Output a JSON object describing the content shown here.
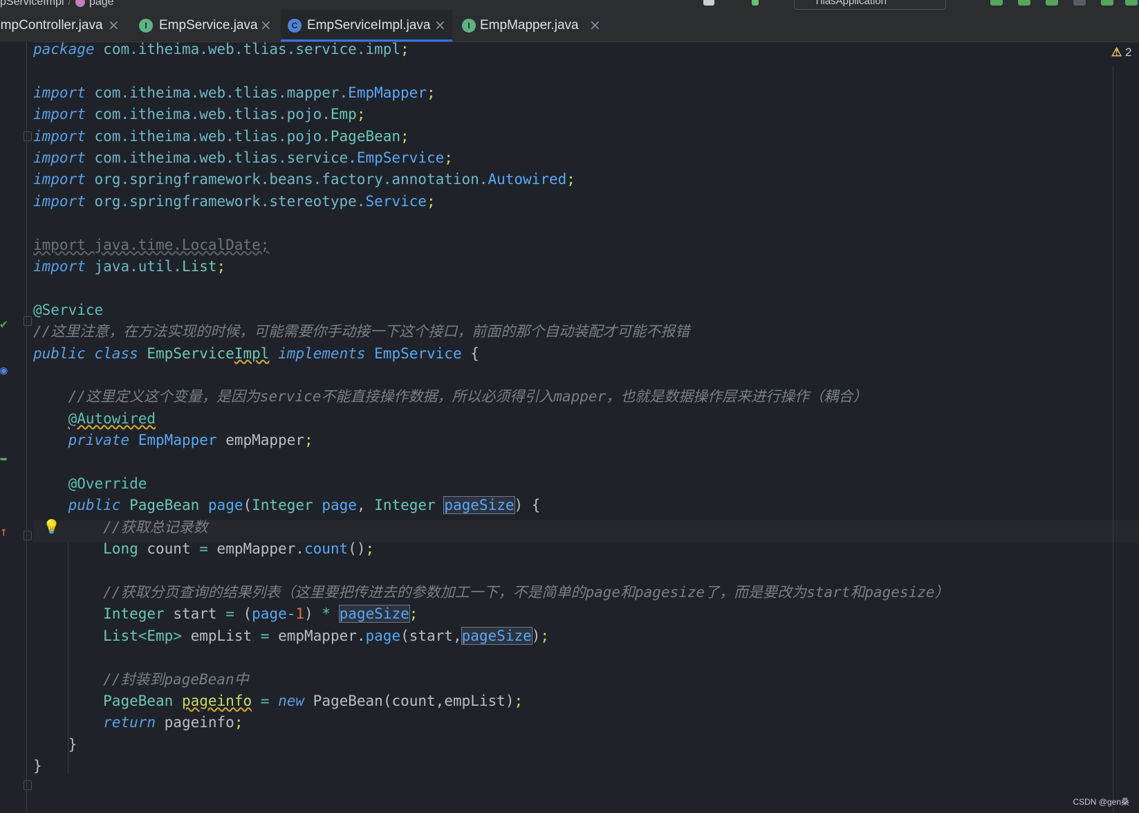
{
  "breadcrumb": {
    "class_part": "pServiceImpl",
    "separator": "/",
    "method": "page"
  },
  "run_config": {
    "label": "TliasApplication"
  },
  "tabs": [
    {
      "label": "EmpController.java",
      "close": "×",
      "badge": ""
    },
    {
      "label": "EmpService.java",
      "close": "×",
      "badge": "I"
    },
    {
      "label": "EmpServiceImpl.java",
      "close": "×",
      "badge": "C",
      "active": true
    },
    {
      "label": "EmpMapper.java",
      "close": "×",
      "badge": "I"
    }
  ],
  "inspections": {
    "icon": "⚠",
    "count": "2"
  },
  "watermark": "CSDN @gen桑",
  "code": [
    [
      [
        "kw",
        "package"
      ],
      [
        "pl",
        " "
      ],
      [
        "pk",
        "com.itheima.web.tlias.service.impl"
      ],
      [
        "sm",
        ";"
      ]
    ],
    [],
    [
      [
        "kw",
        "import"
      ],
      [
        "pl",
        " "
      ],
      [
        "pk",
        "com.itheima.web.tlias.mapper."
      ],
      [
        "ci",
        "EmpMapper"
      ],
      [
        "sm",
        ";"
      ]
    ],
    [
      [
        "kw",
        "import"
      ],
      [
        "pl",
        " "
      ],
      [
        "pk",
        "com.itheima.web.tlias.pojo."
      ],
      [
        "cl",
        "Emp"
      ],
      [
        "sm",
        ";"
      ]
    ],
    [
      [
        "kw",
        "import"
      ],
      [
        "pl",
        " "
      ],
      [
        "pk",
        "com.itheima.web.tlias.pojo."
      ],
      [
        "cl",
        "PageBean"
      ],
      [
        "sm",
        ";"
      ]
    ],
    [
      [
        "kw",
        "import"
      ],
      [
        "pl",
        " "
      ],
      [
        "pk",
        "com.itheima.web.tlias.service."
      ],
      [
        "ci",
        "EmpService"
      ],
      [
        "sm",
        ";"
      ]
    ],
    [
      [
        "kw",
        "import"
      ],
      [
        "pl",
        " "
      ],
      [
        "pk",
        "org.springframework.beans.factory.annotation."
      ],
      [
        "ci",
        "Autowired"
      ],
      [
        "sm",
        ";"
      ]
    ],
    [
      [
        "kw",
        "import"
      ],
      [
        "pl",
        " "
      ],
      [
        "pk",
        "org.springframework.stereotype."
      ],
      [
        "ci",
        "Service"
      ],
      [
        "sm",
        ";"
      ]
    ],
    [],
    [
      [
        "gr",
        "import java.time.LocalDate;"
      ]
    ],
    [
      [
        "kw",
        "import"
      ],
      [
        "pl",
        " "
      ],
      [
        "pk",
        "java.util."
      ],
      [
        "cl",
        "List"
      ],
      [
        "sm",
        ";"
      ]
    ],
    [],
    [
      [
        "an",
        "@Service"
      ]
    ],
    [
      [
        "cm",
        "//这里注意，在方法实现的时候，可能需要你手动接一下这个接口，前面的那个自动装配才可能不报错"
      ]
    ],
    [
      [
        "kw",
        "public"
      ],
      [
        "pl",
        " "
      ],
      [
        "kw",
        "class"
      ],
      [
        "pl",
        " "
      ],
      [
        "cl",
        "EmpService"
      ],
      [
        "cl wv",
        "Impl"
      ],
      [
        "pl",
        " "
      ],
      [
        "kw",
        "implements"
      ],
      [
        "pl",
        " "
      ],
      [
        "ci",
        "EmpService"
      ],
      [
        "pl",
        " {"
      ]
    ],
    [],
    [
      [
        "pl",
        "    "
      ],
      [
        "cm",
        "//这里定义这个变量，是因为service不能直接操作数据，所以必须得引入mapper，也就是数据操作层来进行操作（耦合）"
      ]
    ],
    [
      [
        "pl",
        "    "
      ],
      [
        "an wv",
        "@Autowired"
      ]
    ],
    [
      [
        "pl",
        "    "
      ],
      [
        "kw",
        "private"
      ],
      [
        "pl",
        " "
      ],
      [
        "ci",
        "EmpMapper"
      ],
      [
        "pl",
        " empMapper"
      ],
      [
        "sm",
        ";"
      ]
    ],
    [],
    [
      [
        "pl",
        "    "
      ],
      [
        "an",
        "@Override"
      ]
    ],
    [
      [
        "pl",
        "    "
      ],
      [
        "kw",
        "public"
      ],
      [
        "pl",
        " "
      ],
      [
        "cl",
        "PageBean"
      ],
      [
        "pl",
        " "
      ],
      [
        "mt",
        "page"
      ],
      [
        "pl",
        "("
      ],
      [
        "cl",
        "Integer"
      ],
      [
        "pl",
        " "
      ],
      [
        "ci",
        "page"
      ],
      [
        "pl",
        ", "
      ],
      [
        "cl",
        "Integer"
      ],
      [
        "pl",
        " "
      ],
      [
        "ci bx",
        "pageSize"
      ],
      [
        "pl",
        ") {"
      ]
    ],
    [
      [
        "pl",
        "        "
      ],
      [
        "cm",
        "//获取总记录数"
      ]
    ],
    [
      [
        "pl",
        "        "
      ],
      [
        "cl",
        "Long"
      ],
      [
        "pl",
        " count "
      ],
      [
        "op",
        "="
      ],
      [
        "pl",
        " empMapper."
      ],
      [
        "mt",
        "count"
      ],
      [
        "pl",
        "()"
      ],
      [
        "sm",
        ";"
      ]
    ],
    [],
    [
      [
        "pl",
        "        "
      ],
      [
        "cm",
        "//获取分页查询的结果列表（这里要把传进去的参数加工一下，不是简单的page和pagesize了，而是要改为start和pagesize）"
      ]
    ],
    [
      [
        "pl",
        "        "
      ],
      [
        "cl",
        "Integer"
      ],
      [
        "pl",
        " start "
      ],
      [
        "op",
        "="
      ],
      [
        "pl",
        " ("
      ],
      [
        "ci",
        "page"
      ],
      [
        "op",
        "-"
      ],
      [
        "nm",
        "1"
      ],
      [
        "pl",
        ") "
      ],
      [
        "op",
        "*"
      ],
      [
        "pl",
        " "
      ],
      [
        "ci bx",
        "pageSize"
      ],
      [
        "sm",
        ";"
      ]
    ],
    [
      [
        "pl",
        "        "
      ],
      [
        "cl",
        "List"
      ],
      [
        "op",
        "<"
      ],
      [
        "cl",
        "Emp"
      ],
      [
        "op",
        ">"
      ],
      [
        "pl",
        " empList "
      ],
      [
        "op",
        "="
      ],
      [
        "pl",
        " empMapper."
      ],
      [
        "mt",
        "page"
      ],
      [
        "pl",
        "(start,"
      ],
      [
        "ci bx",
        "pageSize"
      ],
      [
        "pl",
        ")"
      ],
      [
        "sm",
        ";"
      ]
    ],
    [],
    [
      [
        "pl",
        "        "
      ],
      [
        "cm",
        "//封装到pageBean中"
      ]
    ],
    [
      [
        "pl",
        "        "
      ],
      [
        "cl",
        "PageBean"
      ],
      [
        "pl",
        " "
      ],
      [
        "sm wv",
        "pageinfo"
      ],
      [
        "pl",
        " "
      ],
      [
        "op",
        "="
      ],
      [
        "pl",
        " "
      ],
      [
        "kw",
        "new"
      ],
      [
        "pl",
        " PageBean(count,empList)"
      ],
      [
        "sm",
        ";"
      ]
    ],
    [
      [
        "pl",
        "        "
      ],
      [
        "kw",
        "return"
      ],
      [
        "pl",
        " pageinfo"
      ],
      [
        "sm",
        ";"
      ]
    ],
    [
      [
        "pl",
        "    }"
      ]
    ],
    [
      [
        "pl",
        "}"
      ]
    ]
  ]
}
